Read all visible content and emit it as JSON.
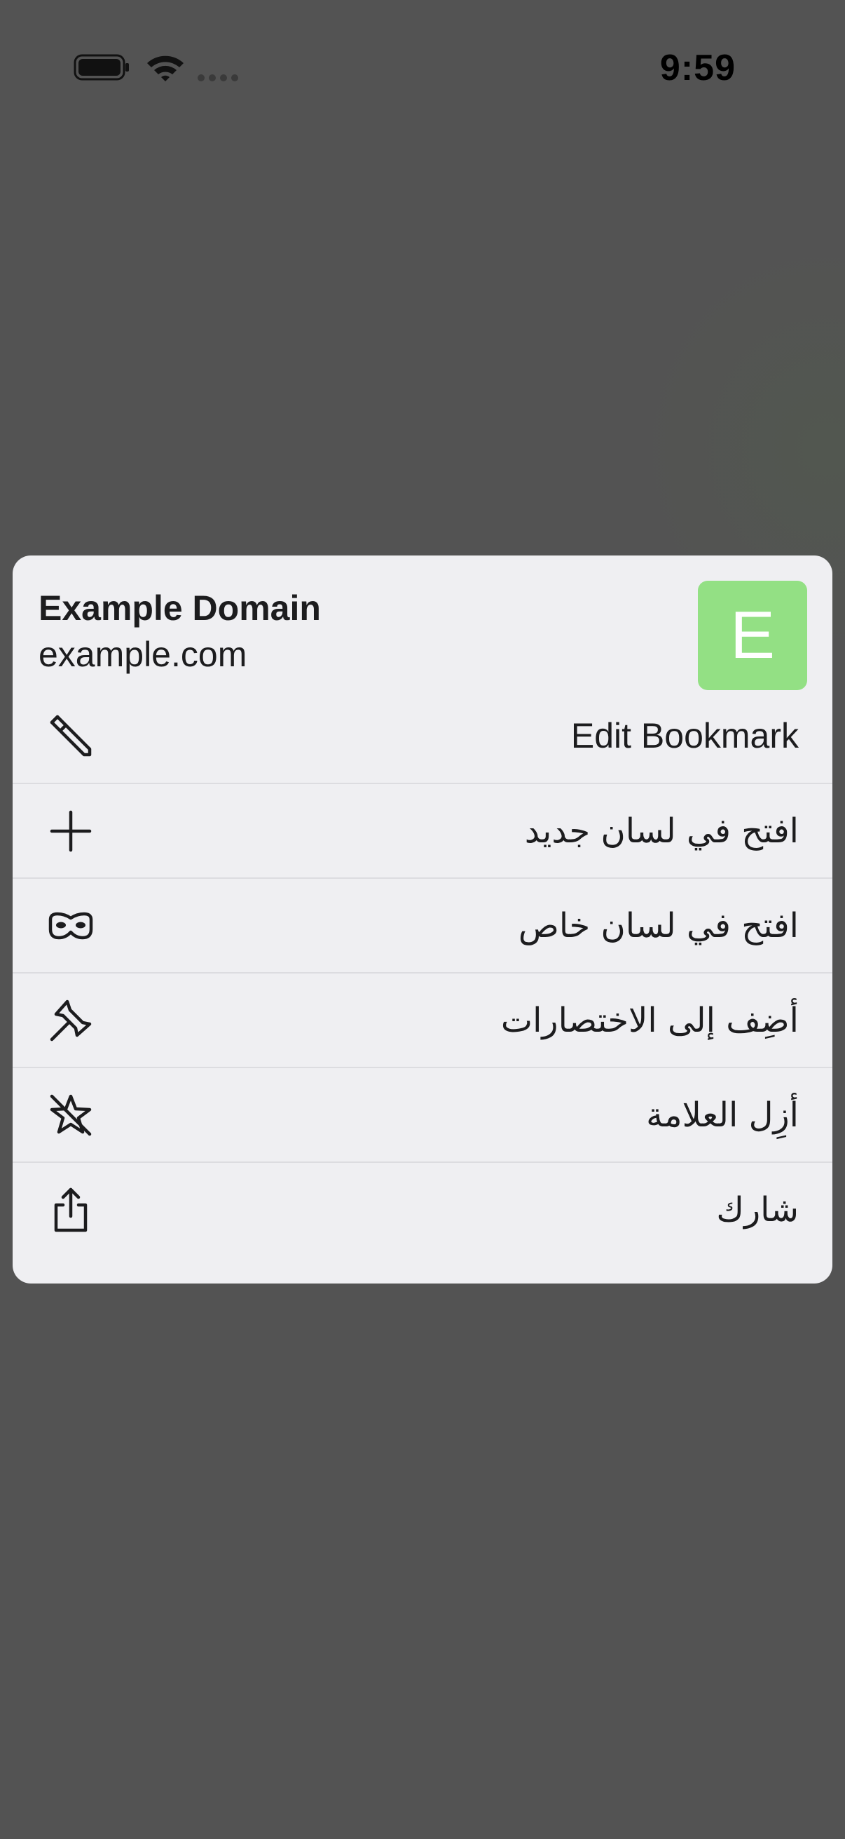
{
  "status_bar": {
    "time": "9:59",
    "battery_icon": "battery-full-icon",
    "wifi_icon": "wifi-icon",
    "cellular_icon": "cellular-no-signal-icon"
  },
  "context_menu": {
    "site_title": "Example Domain",
    "site_url": "example.com",
    "favicon_letter": "E",
    "favicon_color": "#93e084",
    "items": [
      {
        "label": "Edit Bookmark",
        "icon": "pencil-icon"
      },
      {
        "label": "افتح في لسان جديد",
        "icon": "plus-icon"
      },
      {
        "label": "افتح في لسان خاص",
        "icon": "private-mask-icon"
      },
      {
        "label": "أضِف إلى الاختصارات",
        "icon": "pin-icon"
      },
      {
        "label": "أزِل العلامة",
        "icon": "star-slash-icon"
      },
      {
        "label": "شارك",
        "icon": "share-icon"
      }
    ]
  },
  "colors": {
    "backdrop": "#535353",
    "menu_background": "#efeff2",
    "text": "#1c1c1e"
  }
}
